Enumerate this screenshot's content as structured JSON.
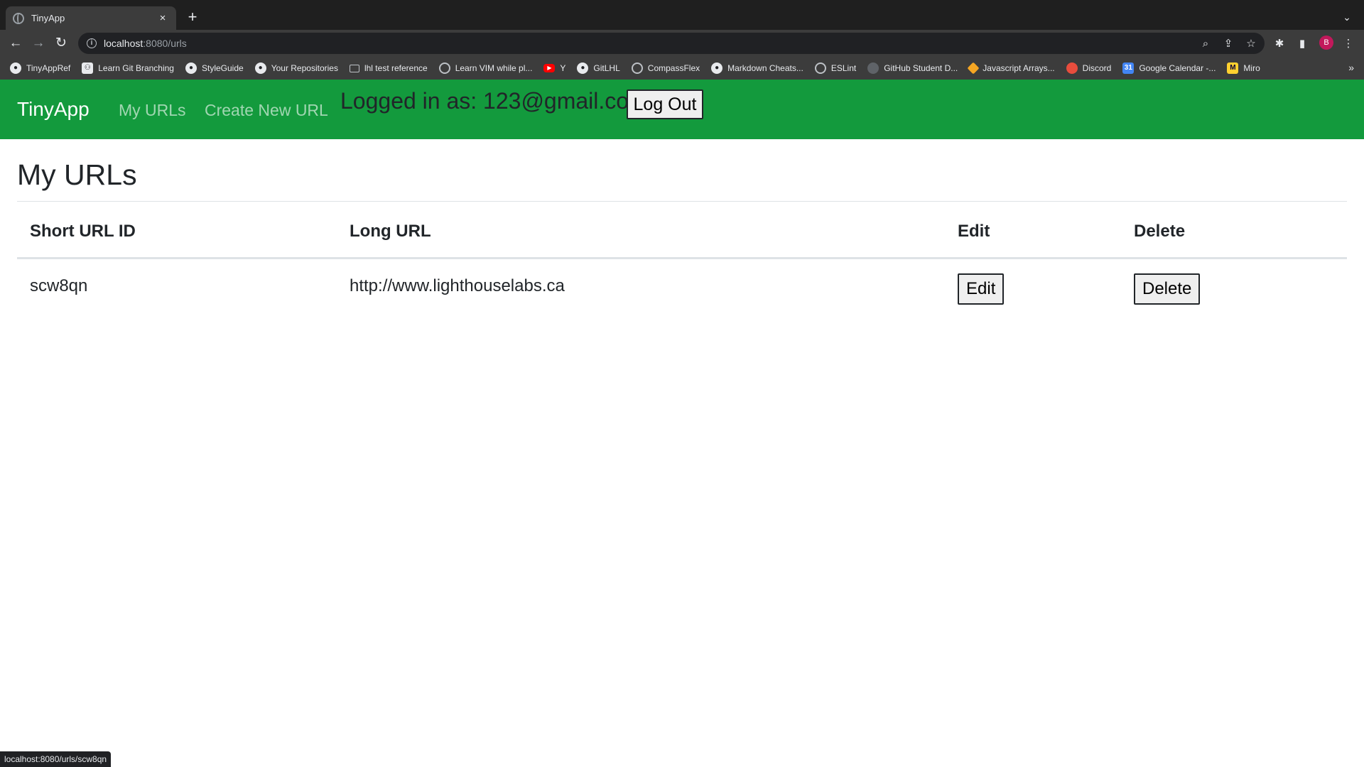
{
  "browser": {
    "tab": {
      "title": "TinyApp",
      "close": "×",
      "new_tab": "+"
    },
    "tab_list": "⌄",
    "toolbar": {
      "back": "←",
      "forward": "→",
      "reload": "↻",
      "info": "i"
    },
    "address": {
      "host": "localhost",
      "path": ":8080/urls"
    },
    "icons": {
      "zoom": "⌕",
      "share": "⇪",
      "star": "☆",
      "extensions": "✱",
      "sidepanel": "▮",
      "menu": "⋮"
    },
    "profile_initial": "B",
    "bookmarks": [
      {
        "label": "TinyAppRef",
        "icon": "github-icon",
        "glyph": "●"
      },
      {
        "label": "Learn Git Branching",
        "icon": "git-branching-icon",
        "glyph": "⚇"
      },
      {
        "label": "StyleGuide",
        "icon": "github-icon",
        "glyph": "●"
      },
      {
        "label": "Your Repositories",
        "icon": "github-icon",
        "glyph": "●"
      },
      {
        "label": "lhl test reference",
        "icon": "folder-icon",
        "glyph": ""
      },
      {
        "label": "Learn VIM while pl...",
        "icon": "globe-icon",
        "glyph": ""
      },
      {
        "label": "Y",
        "icon": "youtube-icon",
        "glyph": "▶"
      },
      {
        "label": "GitLHL",
        "icon": "github-icon",
        "glyph": "●"
      },
      {
        "label": "CompassFlex",
        "icon": "compass-icon",
        "glyph": ""
      },
      {
        "label": "Markdown Cheats...",
        "icon": "github-icon",
        "glyph": "●"
      },
      {
        "label": "ESLint",
        "icon": "eslint-icon",
        "glyph": ""
      },
      {
        "label": "GitHub Student D...",
        "icon": "github-student-icon",
        "glyph": ""
      },
      {
        "label": "Javascript Arrays...",
        "icon": "diamond-icon",
        "glyph": ""
      },
      {
        "label": "Discord",
        "icon": "discord-icon",
        "glyph": ""
      },
      {
        "label": "Google Calendar -...",
        "icon": "google-calendar-icon",
        "glyph": "31"
      },
      {
        "label": "Miro",
        "icon": "miro-icon",
        "glyph": "M"
      }
    ],
    "bookmarks_more": "»",
    "status_url": "localhost:8080/urls/scw8qn"
  },
  "nav": {
    "brand": "TinyApp",
    "my_urls": "My URLs",
    "create_new": "Create New URL",
    "logged_in": "Logged in as: 123@gmail.com",
    "logout": "Log Out"
  },
  "main": {
    "heading": "My URLs",
    "columns": [
      "Short URL ID",
      "Long URL",
      "Edit",
      "Delete"
    ],
    "rows": [
      {
        "short_id": "scw8qn",
        "long_url": "http://www.lighthouselabs.ca",
        "edit_label": "Edit",
        "delete_label": "Delete"
      }
    ]
  }
}
